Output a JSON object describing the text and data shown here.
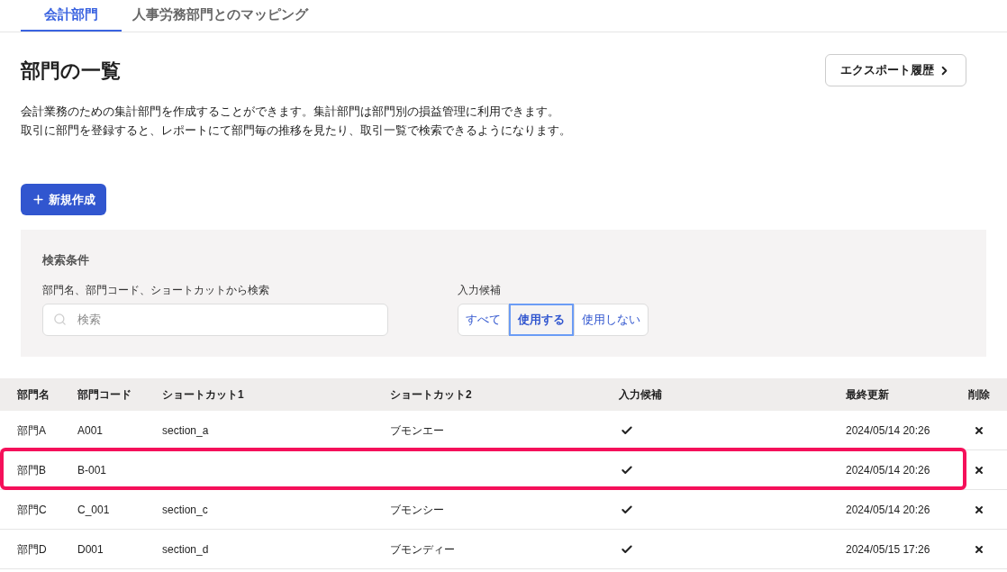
{
  "tabs": [
    {
      "label": "会計部門",
      "selected": true
    },
    {
      "label": "人事労務部門とのマッピング",
      "selected": false
    }
  ],
  "title": "部門の一覧",
  "export_button": "エクスポート履歴",
  "description": [
    "会計業務のための集計部門を作成することができます。集計部門は部門別の損益管理に利用できます。",
    "取引に部門を登録すると、レポートにて部門毎の推移を見たり、取引一覧で検索できるようになります。"
  ],
  "new_button": "新規作成",
  "search_panel": {
    "title": "検索条件",
    "search_label": "部門名、部門コード、ショートカットから検索",
    "placeholder": "検索",
    "filter_label": "入力候補",
    "filter_options": [
      {
        "label": "すべて",
        "selected": false
      },
      {
        "label": "使用する",
        "selected": true
      },
      {
        "label": "使用しない",
        "selected": false
      }
    ]
  },
  "table": {
    "columns": [
      "部門名",
      "部門コード",
      "ショートカット1",
      "ショートカット2",
      "入力候補",
      "最終更新",
      "削除"
    ],
    "rows": [
      {
        "name": "部門A",
        "code": "A001",
        "shortcut1": "section_a",
        "shortcut2": "ブモンエー",
        "candidate": true,
        "updated": "2024/05/14 20:26",
        "highlighted": false
      },
      {
        "name": "部門B",
        "code": "B-001",
        "candidate": true,
        "updated": "2024/05/14 20:26",
        "highlighted": true
      },
      {
        "name": "部門C",
        "code": "C_001",
        "shortcut1": "section_c",
        "shortcut2": "ブモンシー",
        "candidate": true,
        "updated": "2024/05/14 20:26",
        "highlighted": false
      },
      {
        "name": "部門D",
        "code": "D001",
        "shortcut1": "section_d",
        "shortcut2": "ブモンディー",
        "candidate": true,
        "updated": "2024/05/15 17:26",
        "highlighted": false
      }
    ]
  }
}
